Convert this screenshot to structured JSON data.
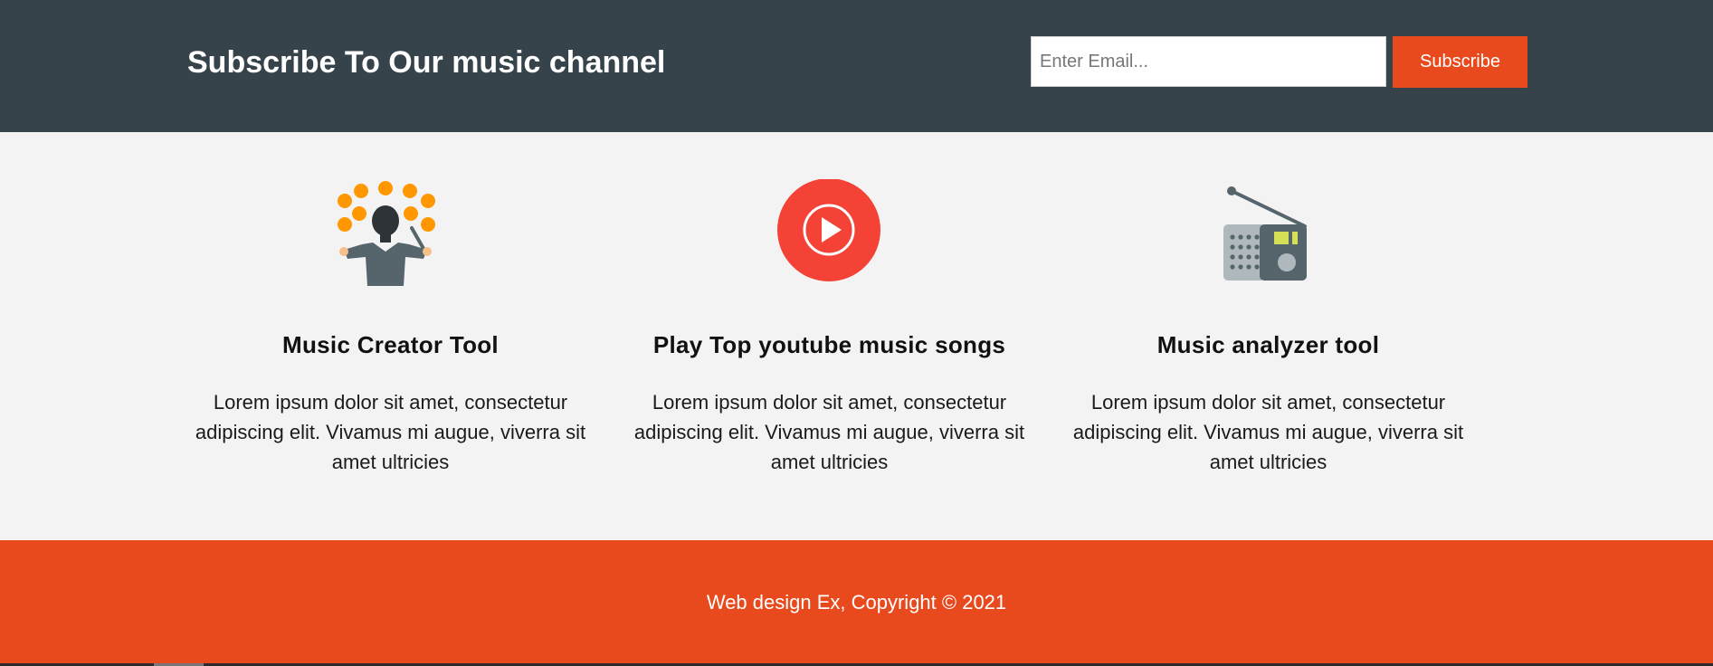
{
  "header": {
    "title": "Subscribe To Our music channel",
    "email_placeholder": "Enter Email...",
    "email_value": "",
    "subscribe_label": "Subscribe"
  },
  "features": [
    {
      "icon": "conductor-icon",
      "title": "Music Creator Tool",
      "text": "Lorem ipsum dolor sit amet, consectetur adipiscing elit. Vivamus mi augue, viverra sit amet ultricies"
    },
    {
      "icon": "play-circle-icon",
      "title": "Play Top youtube music songs",
      "text": "Lorem ipsum dolor sit amet, consectetur adipiscing elit. Vivamus mi augue, viverra sit amet ultricies"
    },
    {
      "icon": "radio-icon",
      "title": "Music analyzer tool",
      "text": "Lorem ipsum dolor sit amet, consectetur adipiscing elit. Vivamus mi augue, viverra sit amet ultricies"
    }
  ],
  "footer": {
    "copyright": "Web design Ex, Copyright © 2021"
  },
  "colors": {
    "header_bg": "#36434b",
    "accent": "#e84a1e",
    "body_bg": "#f4f3f3",
    "play_red": "#f44336",
    "conductor_orange": "#ff9800"
  }
}
